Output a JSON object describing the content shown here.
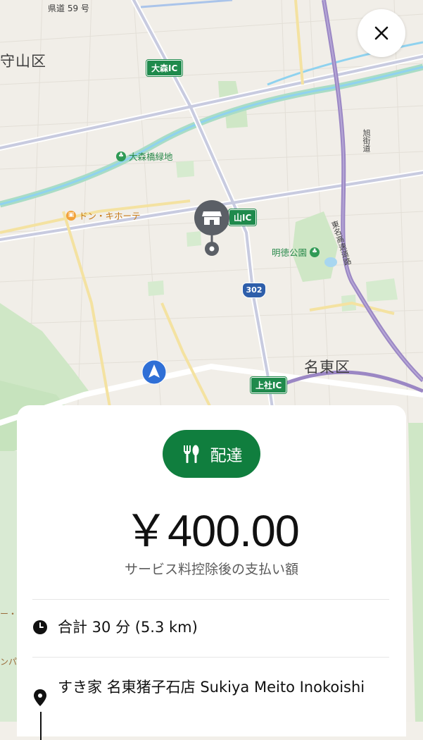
{
  "map": {
    "ward_labels": [
      "守山区",
      "名東区"
    ],
    "road_signs": [
      "大森IC",
      "山IC",
      "上社IC"
    ],
    "route_shield": "302",
    "prefectural_road": "県道 59 号",
    "highway_label": "東名高速道路",
    "street_label": "旭街道",
    "pois": [
      {
        "name": "大森橋緑地",
        "icon": "park-icon",
        "color": "#2f9a55"
      },
      {
        "name": "ドン・キホーテ",
        "icon": "shopping-bag-icon",
        "color": "#f2a23a"
      },
      {
        "name": "明徳公園",
        "icon": "park-icon",
        "color": "#2f9a55"
      }
    ],
    "edge_labels": [
      "ー・",
      "ンパ"
    ]
  },
  "close_button": {
    "icon": "close-icon"
  },
  "card": {
    "order_type": {
      "label": "配達",
      "icon": "fork-knife-icon",
      "color": "#107e3e"
    },
    "amount": "￥400.00",
    "amount_caption": "サービス料控除後の支払い額",
    "duration": {
      "icon": "clock-icon",
      "text": "合計 30 分 (5.3 km)"
    },
    "pickup": {
      "icon": "location-pin-icon",
      "text": "すき家 名東猪子石店 Sukiya Meito Inokoishi"
    }
  }
}
